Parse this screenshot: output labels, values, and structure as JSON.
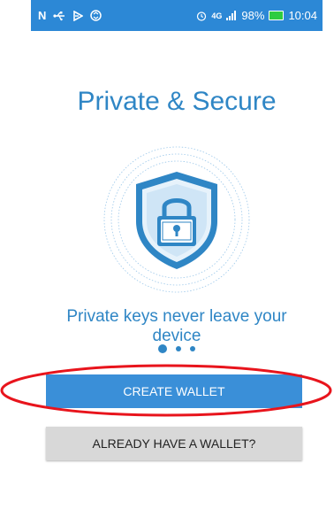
{
  "status_bar": {
    "left_icons": [
      "n-icon",
      "usb-icon",
      "play-icon",
      "sync-icon"
    ],
    "alarm_icon": "alarm-icon",
    "network": "4G",
    "signal_icon": "signal-icon",
    "battery_percent": "98%",
    "battery_icon": "battery-icon",
    "time": "10:04",
    "background_color": "#2c88d6"
  },
  "onboarding": {
    "title": "Private & Secure",
    "subtitle": "Private keys never leave your device",
    "illustration_icon": "shield-lock-icon",
    "page_count": 3,
    "active_page": 1
  },
  "actions": {
    "create_wallet_label": "CREATE WALLET",
    "already_have_wallet_label": "ALREADY HAVE A WALLET?"
  },
  "annotation": {
    "color": "#e8141c",
    "shape": "ellipse",
    "target": "create-wallet-button"
  },
  "colors": {
    "accent": "#2f86c5",
    "primary_button": "#3a8fd8",
    "secondary_button": "#d8d8d8"
  }
}
